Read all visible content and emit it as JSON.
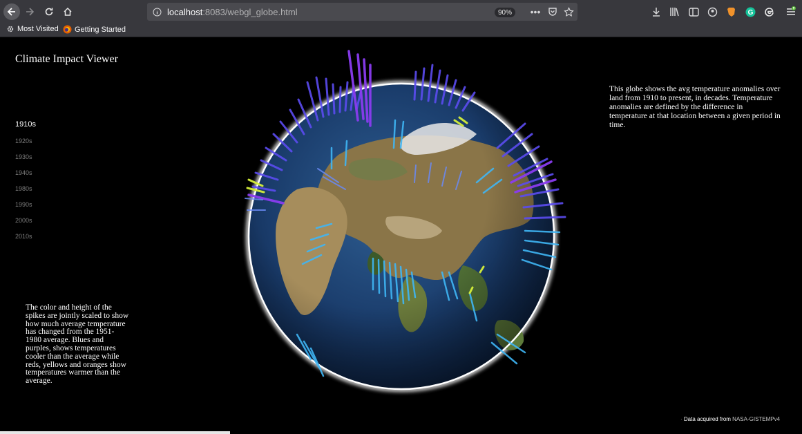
{
  "browser": {
    "url_host": "localhost",
    "url_rest": ":8083/webgl_globe.html",
    "zoom": "90%",
    "bookmarks": [
      {
        "label": "Most Visited",
        "icon": "gear-icon"
      },
      {
        "label": "Getting Started",
        "icon": "firefox-icon"
      }
    ]
  },
  "app": {
    "title": "Climate Impact Viewer",
    "decades": [
      "1910s",
      "1920s",
      "1930s",
      "1940s",
      "1980s",
      "1990s",
      "2000s",
      "2010s"
    ],
    "active_decade": "1910s",
    "description_right": "This globe shows the avg temperature anomalies over land from 1910 to present, in decades. Temperature anomalies are defined by the difference in temperature at that location between a given period in time.",
    "description_left": "The color and height of the spikes are jointly scaled to show how much average temperature has changed from the 1951-1980 average. Blues and purples, shows temperatures cooler than the average while reds, yellows and oranges show temperatures warmer than the average.",
    "source_prefix": "Data acquired from ",
    "source_link": "NASA-GISTEMPv4"
  },
  "colors": {
    "chrome": "#38383d",
    "urlbar": "#4a4a4f",
    "page_bg": "#000000",
    "spike_cool": "#5b4cf0",
    "spike_cold": "#8a3cf0",
    "spike_mild": "#3fb6f5",
    "spike_warm": "#d6f03a"
  }
}
